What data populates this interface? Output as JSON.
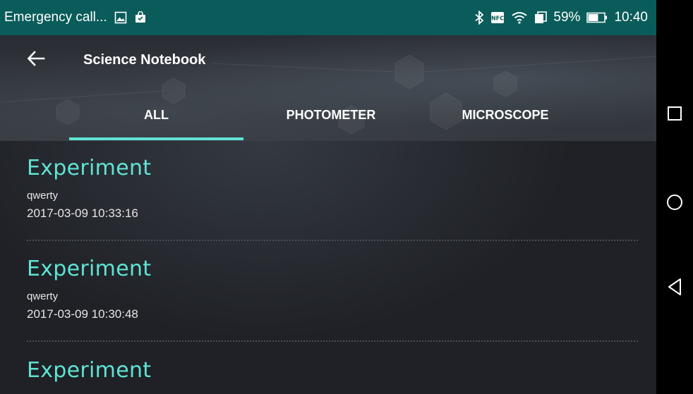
{
  "status_bar": {
    "notification_text": "Emergency call...",
    "battery_percent": "59%",
    "time": "10:40",
    "icons": [
      "image-icon",
      "shopping-bag-icon",
      "bluetooth-icon",
      "nfc-icon",
      "wifi-icon",
      "vibrate-icon",
      "battery-icon"
    ]
  },
  "header": {
    "title": "Science Notebook",
    "back_icon": "arrow-left-icon"
  },
  "tabs": [
    {
      "label": "ALL",
      "selected": true
    },
    {
      "label": "PHOTOMETER",
      "selected": false
    },
    {
      "label": "MICROSCOPE",
      "selected": false
    }
  ],
  "accent_color": "#5fe3d4",
  "statusbar_color": "#0a5c5a",
  "experiments": [
    {
      "title": "Experiment",
      "subtitle": "qwerty",
      "date": "2017-03-09 10:33:16"
    },
    {
      "title": "Experiment",
      "subtitle": "qwerty",
      "date": "2017-03-09 10:30:48"
    },
    {
      "title": "Experiment",
      "subtitle": "",
      "date": ""
    }
  ],
  "nav_bar": {
    "buttons": [
      "recents-square-icon",
      "home-circle-icon",
      "back-triangle-icon"
    ]
  }
}
